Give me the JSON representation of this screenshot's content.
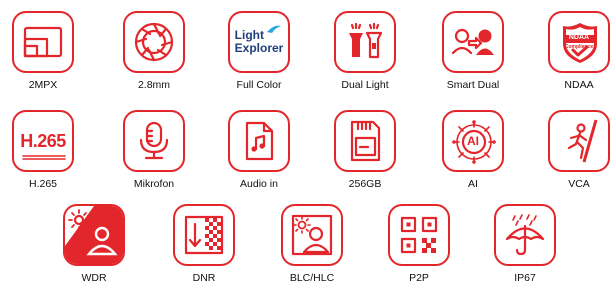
{
  "theme": {
    "accent": "#e3262b",
    "background": "#ffffff",
    "text": "#111111"
  },
  "features": [
    {
      "label": "2MPX",
      "icon": "resolution-icon"
    },
    {
      "label": "2.8mm",
      "icon": "lens-aperture-icon"
    },
    {
      "label": "Full Color",
      "icon": "light-explorer-logo",
      "logo_text": [
        "Light",
        "Explorer"
      ]
    },
    {
      "label": "Dual Light",
      "icon": "dual-light-icon"
    },
    {
      "label": "Smart Dual",
      "icon": "smart-dual-icon"
    },
    {
      "label": "NDAA",
      "icon": "ndaa-badge-icon",
      "badge_text": [
        "NDAA",
        "Compliance"
      ]
    },
    {
      "label": "H.265",
      "icon": "h265-codec-icon",
      "icon_text": "H.265"
    },
    {
      "label": "Mikrofon",
      "icon": "microphone-icon"
    },
    {
      "label": "Audio in",
      "icon": "audio-file-icon"
    },
    {
      "label": "256GB",
      "icon": "sd-card-icon"
    },
    {
      "label": "AI",
      "icon": "ai-chip-icon",
      "icon_text": "AI"
    },
    {
      "label": "VCA",
      "icon": "intrusion-person-icon"
    },
    {
      "label": "WDR",
      "icon": "wdr-icon"
    },
    {
      "label": "DNR",
      "icon": "noise-reduction-icon"
    },
    {
      "label": "BLC/HLC",
      "icon": "backlight-compensation-icon"
    },
    {
      "label": "P2P",
      "icon": "qr-code-icon"
    },
    {
      "label": "IP67",
      "icon": "weatherproof-umbrella-icon"
    }
  ]
}
